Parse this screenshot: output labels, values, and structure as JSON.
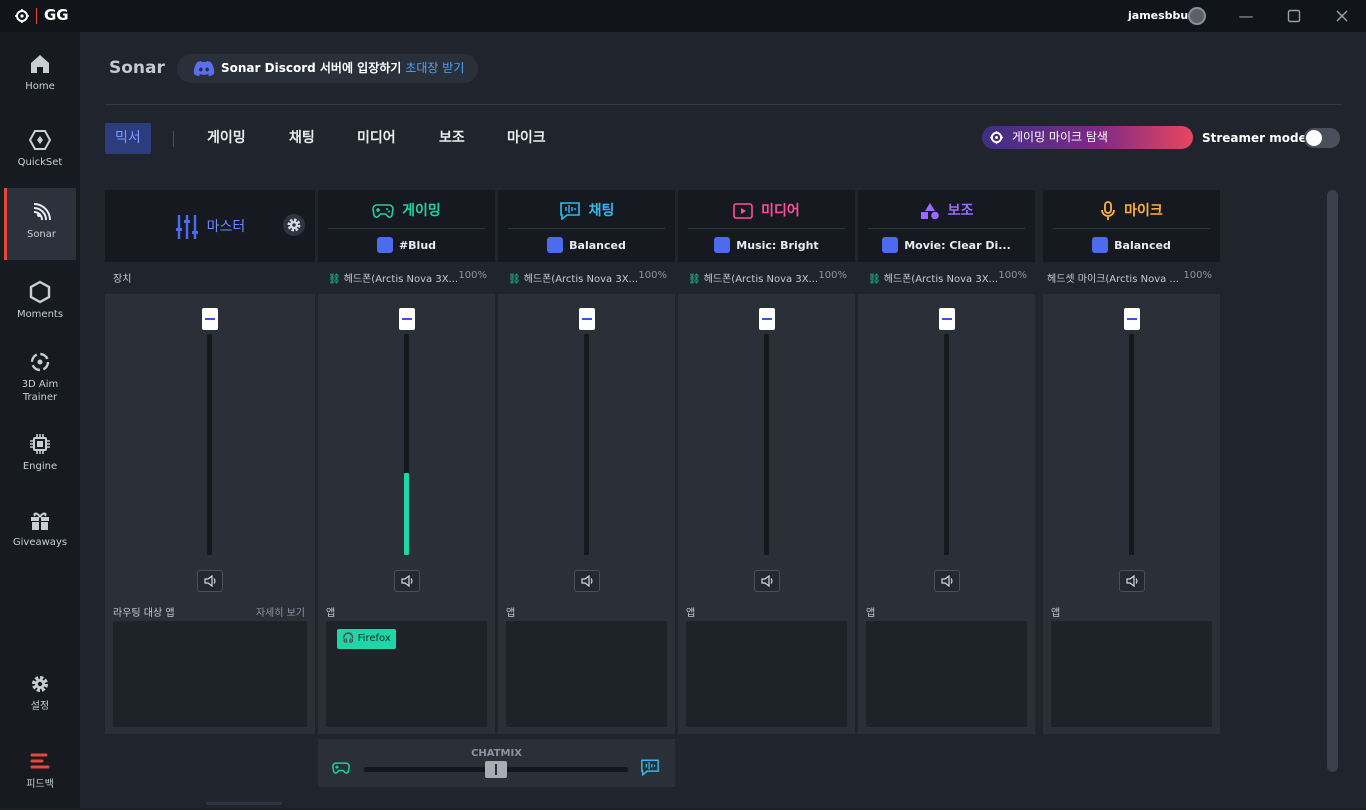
{
  "titlebar": {
    "app_name": "GG",
    "username": "jamesbbun",
    "logo_icon": "steelseries-logo-icon",
    "controls": [
      "minimize-icon",
      "maximize-icon",
      "close-icon"
    ]
  },
  "sidebar": {
    "items": [
      {
        "label": "Home",
        "icon": "home-icon"
      },
      {
        "label": "QuickSet",
        "icon": "quickset-icon"
      },
      {
        "label": "Sonar",
        "icon": "sonar-icon",
        "active": true
      },
      {
        "label": "Moments",
        "icon": "moments-icon"
      },
      {
        "label": "3D Aim Trainer",
        "icon": "aim-trainer-icon"
      },
      {
        "label": "Engine",
        "icon": "engine-icon"
      },
      {
        "label": "Giveaways",
        "icon": "gift-icon"
      },
      {
        "label": "설정",
        "icon": "settings-icon"
      },
      {
        "label": "피드백",
        "icon": "feedback-icon"
      }
    ]
  },
  "header": {
    "title": "Sonar",
    "discord_text": "Sonar Discord 서버에 입장하기",
    "discord_invite": "초대장 받기"
  },
  "tabs": [
    "믹서",
    "게이밍",
    "채팅",
    "미디어",
    "보조",
    "마이크"
  ],
  "active_tab": "믹서",
  "mic_promo": "게이밍 마이크 탐색",
  "streamer_mode": {
    "label": "Streamer mode",
    "enabled": false
  },
  "colors": {
    "accent_blue": "#4c6bef",
    "gaming": "#1fd1a5",
    "chat": "#35b8f0",
    "media": "#ff4d9d",
    "aux": "#9b6bff",
    "mic": "#ffb13c"
  },
  "master": {
    "title": "마스터",
    "device_label": "장치",
    "apps_label": "라우팅 대상 앱",
    "apps_more": "자세히 보기"
  },
  "channels": [
    {
      "id": "gaming",
      "title": "게이밍",
      "preset": "#Blud",
      "device": "헤드폰(Arctis Nova 3X...",
      "volume": "100%",
      "apps_label": "앱",
      "apps": [
        "Firefox"
      ],
      "level": 0.37
    },
    {
      "id": "chat",
      "title": "채팅",
      "preset": "Balanced",
      "device": "헤드폰(Arctis Nova 3X...",
      "volume": "100%",
      "apps_label": "앱",
      "apps": [],
      "level": 0
    },
    {
      "id": "media",
      "title": "미디어",
      "preset": "Music: Bright",
      "device": "헤드폰(Arctis Nova 3X...",
      "volume": "100%",
      "apps_label": "앱",
      "apps": [],
      "level": 0
    },
    {
      "id": "aux",
      "title": "보조",
      "preset": "Movie: Clear Di...",
      "device": "헤드폰(Arctis Nova 3X...",
      "volume": "100%",
      "apps_label": "앱",
      "apps": [],
      "level": 0
    },
    {
      "id": "mic",
      "title": "마이크",
      "preset": "Balanced",
      "device": "헤드셋 마이크(Arctis Nova ...",
      "volume": "100%",
      "apps_label": "앱",
      "apps": [],
      "level": 0
    }
  ],
  "chatmix": {
    "label": "CHATMIX",
    "balance": 0.5
  }
}
